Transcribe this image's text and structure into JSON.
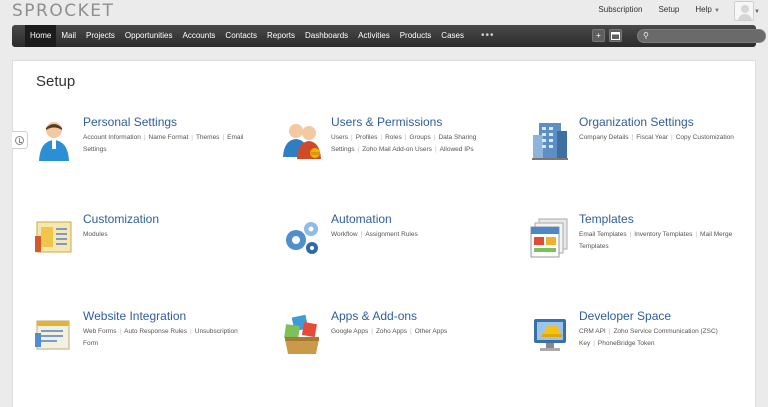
{
  "brand": "SPROCKET",
  "toplinks": {
    "subscription": "Subscription",
    "setup": "Setup",
    "help": "Help"
  },
  "nav": {
    "items": [
      "Home",
      "Mail",
      "Projects",
      "Opportunities",
      "Accounts",
      "Contacts",
      "Reports",
      "Dashboards",
      "Activities",
      "Products",
      "Cases"
    ],
    "active": "Home",
    "more": "•••",
    "quick_create": "+"
  },
  "page_title": "Setup",
  "modules": [
    {
      "title": "Personal Settings",
      "icon": "person-icon",
      "links": [
        "Account Information",
        "Name Format",
        "Themes",
        "Email Settings"
      ]
    },
    {
      "title": "Users & Permissions",
      "icon": "users-icon",
      "links": [
        "Users",
        "Profiles",
        "Roles",
        "Groups",
        "Data Sharing Settings",
        "Zoho Mail Add-on Users",
        "Allowed IPs"
      ]
    },
    {
      "title": "Organization Settings",
      "icon": "building-icon",
      "links": [
        "Company Details",
        "Fiscal Year",
        "Copy Customization"
      ]
    },
    {
      "title": "Customization",
      "icon": "layout-icon",
      "links": [
        "Modules"
      ]
    },
    {
      "title": "Automation",
      "icon": "gears-icon",
      "links": [
        "Workflow",
        "Assignment Rules"
      ]
    },
    {
      "title": "Templates",
      "icon": "templates-icon",
      "links": [
        "Email Templates",
        "Inventory Templates",
        "Mail Merge Templates"
      ]
    },
    {
      "title": "Website Integration",
      "icon": "web-forms-icon",
      "links": [
        "Web Forms",
        "Auto Response Rules",
        "Unsubscription Form"
      ]
    },
    {
      "title": "Apps & Add-ons",
      "icon": "apps-icon",
      "links": [
        "Google Apps",
        "Zoho Apps",
        "Other Apps"
      ]
    },
    {
      "title": "Developer Space",
      "icon": "developer-icon",
      "links": [
        "CRM API",
        "Zoho Service Communication (ZSC) Key",
        "PhoneBridge Token"
      ]
    }
  ]
}
